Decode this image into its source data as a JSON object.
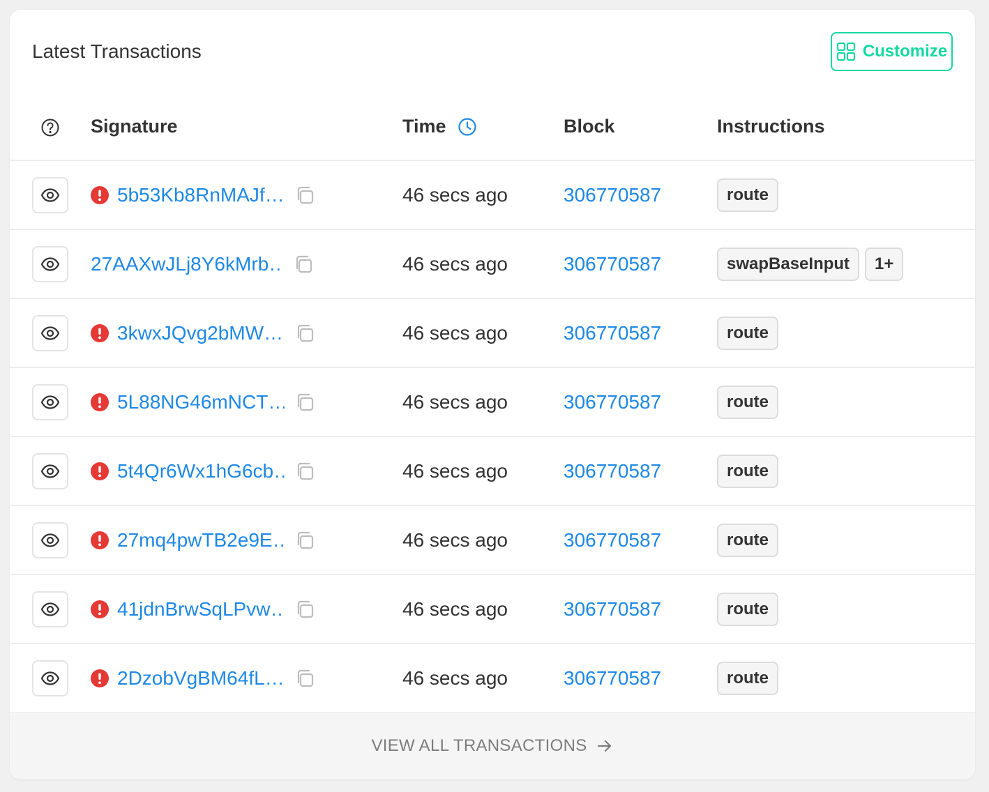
{
  "header": {
    "title": "Latest Transactions",
    "customize_label": "Customize"
  },
  "columns": {
    "signature": "Signature",
    "time": "Time",
    "block": "Block",
    "instructions": "Instructions"
  },
  "transactions": [
    {
      "signature": "5b53Kb8RnMAJf…",
      "error": true,
      "time": "46 secs ago",
      "block": "306770587",
      "instructions": [
        "route"
      ]
    },
    {
      "signature": "27AAXwJLj8Y6kMrb…",
      "error": false,
      "time": "46 secs ago",
      "block": "306770587",
      "instructions": [
        "swapBaseInput",
        "1+"
      ]
    },
    {
      "signature": "3kwxJQvg2bMW…",
      "error": true,
      "time": "46 secs ago",
      "block": "306770587",
      "instructions": [
        "route"
      ]
    },
    {
      "signature": "5L88NG46mNCT…",
      "error": true,
      "time": "46 secs ago",
      "block": "306770587",
      "instructions": [
        "route"
      ]
    },
    {
      "signature": "5t4Qr6Wx1hG6cb…",
      "error": true,
      "time": "46 secs ago",
      "block": "306770587",
      "instructions": [
        "route"
      ]
    },
    {
      "signature": "27mq4pwTB2e9E…",
      "error": true,
      "time": "46 secs ago",
      "block": "306770587",
      "instructions": [
        "route"
      ]
    },
    {
      "signature": "41jdnBrwSqLPvw…",
      "error": true,
      "time": "46 secs ago",
      "block": "306770587",
      "instructions": [
        "route"
      ]
    },
    {
      "signature": "2DzobVgBM64fL…",
      "error": true,
      "time": "46 secs ago",
      "block": "306770587",
      "instructions": [
        "route"
      ]
    }
  ],
  "footer": {
    "label": "VIEW ALL TRANSACTIONS"
  },
  "colors": {
    "accent": "#14d8a2",
    "link": "#1e88e5",
    "error": "#e53935"
  },
  "icons": {
    "customize": "grid-icon",
    "help": "question-circle-icon",
    "time": "clock-icon",
    "view": "eye-icon",
    "error": "exclamation-circle-icon",
    "copy": "copy-icon",
    "footer": "arrow-right-icon"
  }
}
